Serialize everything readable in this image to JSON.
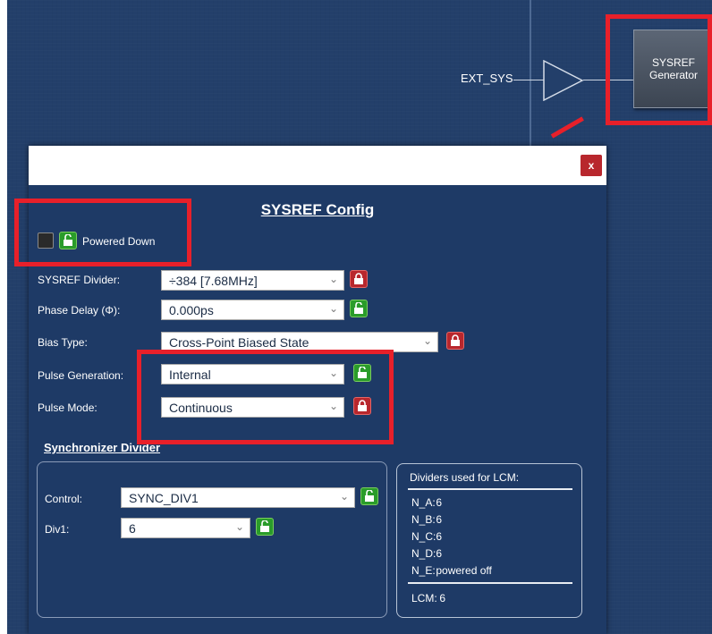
{
  "diagram": {
    "ext_label": "EXT_SYS",
    "block_line1": "SYSREF",
    "block_line2": "Generator"
  },
  "dialog": {
    "close_label": "x",
    "title": "SYSREF Config",
    "powered_label": "Powered Down",
    "rows": {
      "divider": {
        "label": "SYSREF Divider:",
        "value": "÷384 [7.68MHz]"
      },
      "phase": {
        "label": "Phase Delay (Φ):",
        "value": "0.000ps"
      },
      "bias": {
        "label": "Bias Type:",
        "value": "Cross-Point Biased State"
      },
      "pulse_gen": {
        "label": "Pulse Generation:",
        "value": "Internal"
      },
      "pulse_mode": {
        "label": "Pulse Mode:",
        "value": "Continuous"
      }
    }
  },
  "sync": {
    "title": "Synchronizer Divider",
    "control": {
      "label": "Control:",
      "value": "SYNC_DIV1"
    },
    "div1": {
      "label": "Div1:",
      "value": "6"
    }
  },
  "lcm": {
    "title": "Dividers used for LCM:",
    "rows": [
      {
        "key": "N_A:",
        "value": "6"
      },
      {
        "key": "N_B:",
        "value": "6"
      },
      {
        "key": "N_C:",
        "value": "6"
      },
      {
        "key": "N_D:",
        "value": "6"
      },
      {
        "key": "N_E:",
        "value": "powered off"
      }
    ],
    "result": {
      "key": "LCM:",
      "value": "6"
    }
  },
  "icons": {
    "unlocked": "lock-open-icon",
    "locked": "lock-closed-icon",
    "dropdown": "chevron-down-icon"
  },
  "colors": {
    "background": "#233f6a",
    "dialog": "#1e3a66",
    "highlight": "#e8202a",
    "lock_open": "#2a9c2a",
    "lock_closed": "#b8272d"
  }
}
